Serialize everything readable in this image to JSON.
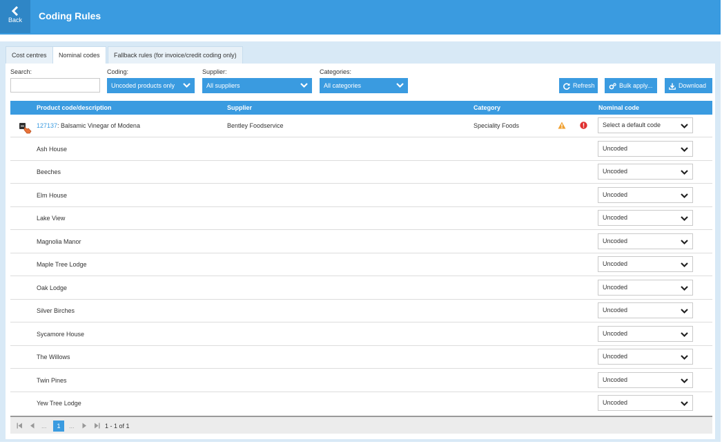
{
  "header": {
    "back_label": "Back",
    "title": "Coding Rules",
    "back_icon": "chevron-left-icon"
  },
  "tabs": [
    {
      "label": "Cost centres",
      "active": false
    },
    {
      "label": "Nominal codes",
      "active": true
    },
    {
      "label": "Fallback rules (for invoice/credit coding only)",
      "active": false
    }
  ],
  "filters": {
    "search_label": "Search:",
    "search_value": "",
    "coding_label": "Coding:",
    "coding_value": "Uncoded products only",
    "supplier_label": "Supplier:",
    "supplier_value": "All suppliers",
    "categories_label": "Categories:",
    "categories_value": "All categories"
  },
  "actions": {
    "refresh": "Refresh",
    "bulk_apply": "Bulk apply...",
    "download": "Download"
  },
  "table": {
    "columns": [
      "Product code/description",
      "Supplier",
      "Category",
      "Nominal code"
    ],
    "product": {
      "code": "127137",
      "description": ": Balsamic Vinegar of Modena",
      "supplier": "Bentley Foodservice",
      "category": "Speciality Foods",
      "nominal_code": "Select a default code"
    },
    "cost_centres": [
      {
        "name": "Ash House",
        "code": "Uncoded"
      },
      {
        "name": "Beeches",
        "code": "Uncoded"
      },
      {
        "name": "Elm House",
        "code": "Uncoded"
      },
      {
        "name": "Lake View",
        "code": "Uncoded"
      },
      {
        "name": "Magnolia Manor",
        "code": "Uncoded"
      },
      {
        "name": "Maple Tree Lodge",
        "code": "Uncoded"
      },
      {
        "name": "Oak Lodge",
        "code": "Uncoded"
      },
      {
        "name": "Silver Birches",
        "code": "Uncoded"
      },
      {
        "name": "Sycamore House",
        "code": "Uncoded"
      },
      {
        "name": "The Willows",
        "code": "Uncoded"
      },
      {
        "name": "Twin Pines",
        "code": "Uncoded"
      },
      {
        "name": "Yew Tree Lodge",
        "code": "Uncoded"
      }
    ]
  },
  "pager": {
    "ellipsis": "...",
    "current_page": "1",
    "info": "1 - 1 of 1"
  },
  "colors": {
    "accent": "#3a9be0",
    "warning": "#f0a030",
    "error": "#e03030"
  }
}
